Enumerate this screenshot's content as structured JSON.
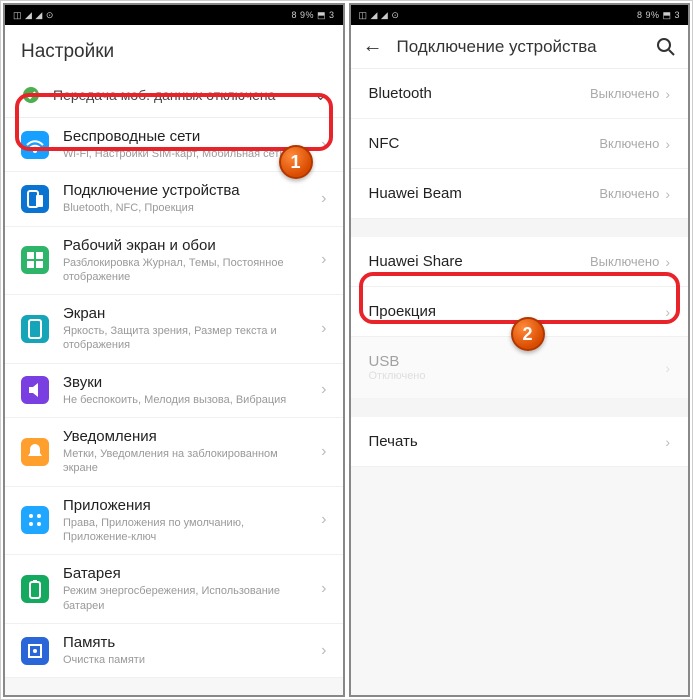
{
  "statusbar": {
    "left": "◫ ◢ ◢ ⊙",
    "right": "8 9% ⬒ 3"
  },
  "left": {
    "header": "Настройки",
    "notice": "Передача моб. данных отключена",
    "items": [
      {
        "title": "Беспроводные сети",
        "sub": "Wi-Fi, Настройки SIM-карт, Мобильная сеть",
        "icon": "wifi",
        "color": "#17a0ff"
      },
      {
        "title": "Подключение устройства",
        "sub": "Bluetooth, NFC, Проекция",
        "icon": "device",
        "color": "#0b73d0"
      },
      {
        "title": "Рабочий экран и обои",
        "sub": "Разблокировка Журнал, Темы, Постоянное отображение",
        "icon": "home",
        "color": "#2fb56a"
      },
      {
        "title": "Экран",
        "sub": "Яркость, Защита зрения, Размер текста и отображения",
        "icon": "display",
        "color": "#16a4b8"
      },
      {
        "title": "Звуки",
        "sub": "Не беспокоить, Мелодия вызова, Вибрация",
        "icon": "sound",
        "color": "#7a3fe0"
      },
      {
        "title": "Уведомления",
        "sub": "Метки, Уведомления на заблокированном экране",
        "icon": "notif",
        "color": "#ff9f2e"
      },
      {
        "title": "Приложения",
        "sub": "Права, Приложения по умолчанию, Приложение-ключ",
        "icon": "apps",
        "color": "#1fa6ff"
      },
      {
        "title": "Батарея",
        "sub": "Режим энергосбережения, Использование батареи",
        "icon": "battery",
        "color": "#15a85f"
      },
      {
        "title": "Память",
        "sub": "Очистка памяти",
        "icon": "memory",
        "color": "#2a66d8"
      }
    ],
    "badge": "1"
  },
  "right": {
    "header": "Подключение устройства",
    "rows1": [
      {
        "label": "Bluetooth",
        "val": "Выключено"
      },
      {
        "label": "NFC",
        "val": "Включено"
      },
      {
        "label": "Huawei Beam",
        "val": "Включено"
      }
    ],
    "rows2": [
      {
        "label": "Huawei Share",
        "val": "Выключено"
      },
      {
        "label": "Проекция",
        "val": ""
      },
      {
        "label": "USB",
        "sub": "Отключено",
        "dim": true
      }
    ],
    "rows3": [
      {
        "label": "Печать",
        "val": ""
      }
    ],
    "badge": "2"
  }
}
